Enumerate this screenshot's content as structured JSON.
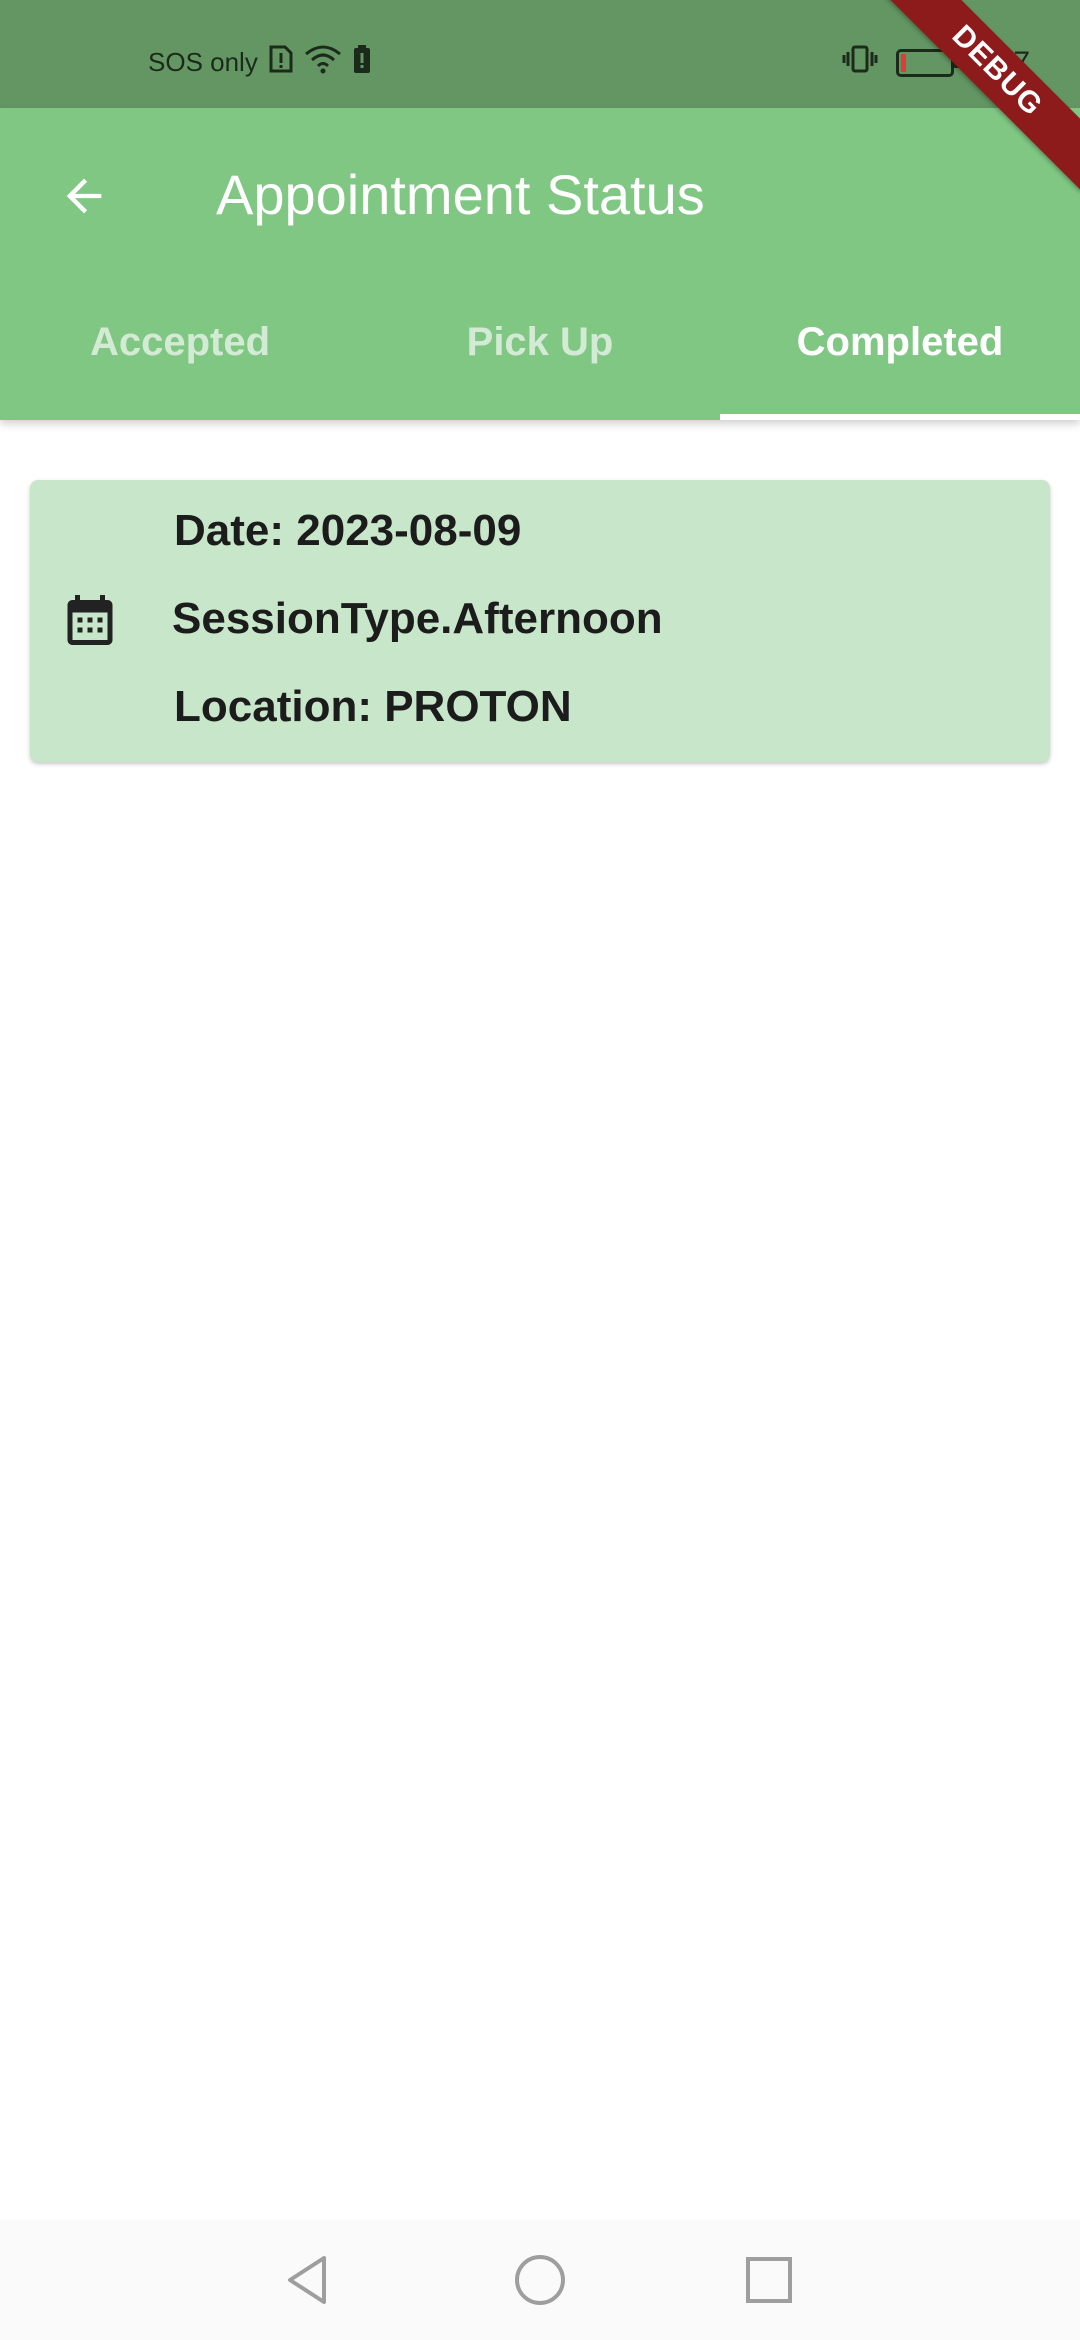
{
  "status_bar": {
    "carrier": "SOS only",
    "time": "3:47",
    "icons": [
      "sim-alert-icon",
      "wifi-icon",
      "battery-saver-icon",
      "vibrate-icon",
      "battery-icon"
    ],
    "battery_level_percent": 10
  },
  "app_bar": {
    "title": "Appointment Status",
    "back_icon": "arrow-back-icon",
    "background": "#81c784"
  },
  "tabs": [
    {
      "label": "Accepted"
    },
    {
      "label": "Pick Up"
    },
    {
      "label": "Completed"
    }
  ],
  "active_tab": "Completed",
  "appointment": {
    "icon": "calendar-icon",
    "date_line": "Date: 2023-08-09",
    "session_line": "SessionType.Afternoon",
    "location_line": "Location: PROTON"
  },
  "debug_banner": "DEBUG",
  "nav_bar": {
    "icons": [
      "back-triangle-icon",
      "home-circle-icon",
      "recents-square-icon"
    ]
  }
}
